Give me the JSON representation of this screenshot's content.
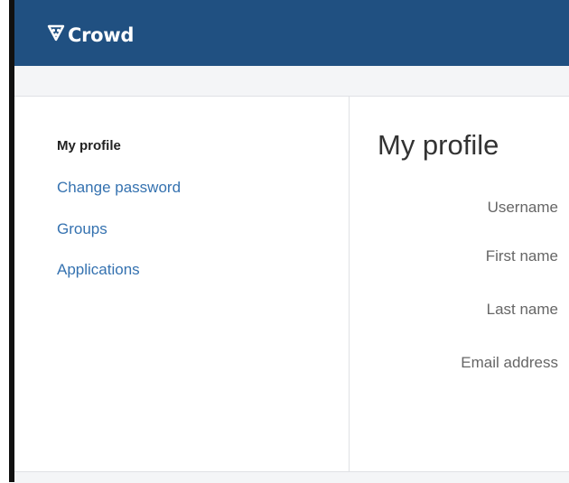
{
  "header": {
    "brand_name": "Crowd",
    "brand_icon": "crowd-logo-icon",
    "background_color": "#205081"
  },
  "sidebar": {
    "items": [
      {
        "label": "My profile",
        "active": true
      },
      {
        "label": "Change password",
        "active": false
      },
      {
        "label": "Groups",
        "active": false
      },
      {
        "label": "Applications",
        "active": false
      }
    ],
    "link_color": "#3572b0"
  },
  "main": {
    "title": "My profile",
    "fields": [
      {
        "label": "Username"
      },
      {
        "label": "First name"
      },
      {
        "label": "Last name"
      },
      {
        "label": "Email address"
      }
    ]
  }
}
